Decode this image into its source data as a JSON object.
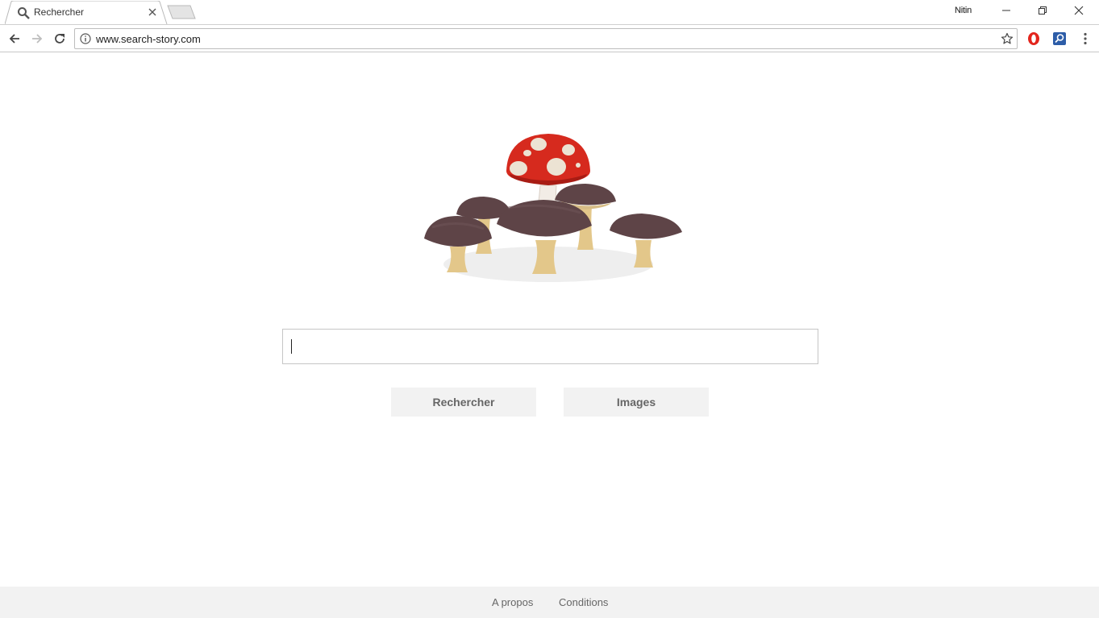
{
  "browser": {
    "tab": {
      "title": "Rechercher",
      "icon": "search-icon"
    },
    "profile_name": "Nitin",
    "url": "www.search-story.com",
    "extensions": [
      "opera-icon",
      "search-extension-icon"
    ]
  },
  "page": {
    "logo_icon": "mushrooms-logo",
    "search_value": "",
    "buttons": {
      "search_label": "Rechercher",
      "images_label": "Images"
    },
    "footer": {
      "about_label": "A propos",
      "terms_label": "Conditions"
    }
  },
  "colors": {
    "accent_red": "#d62a1e",
    "mushroom_brown": "#5e4447",
    "stem": "#e3c78a",
    "footer_bg": "#f2f2f2"
  }
}
